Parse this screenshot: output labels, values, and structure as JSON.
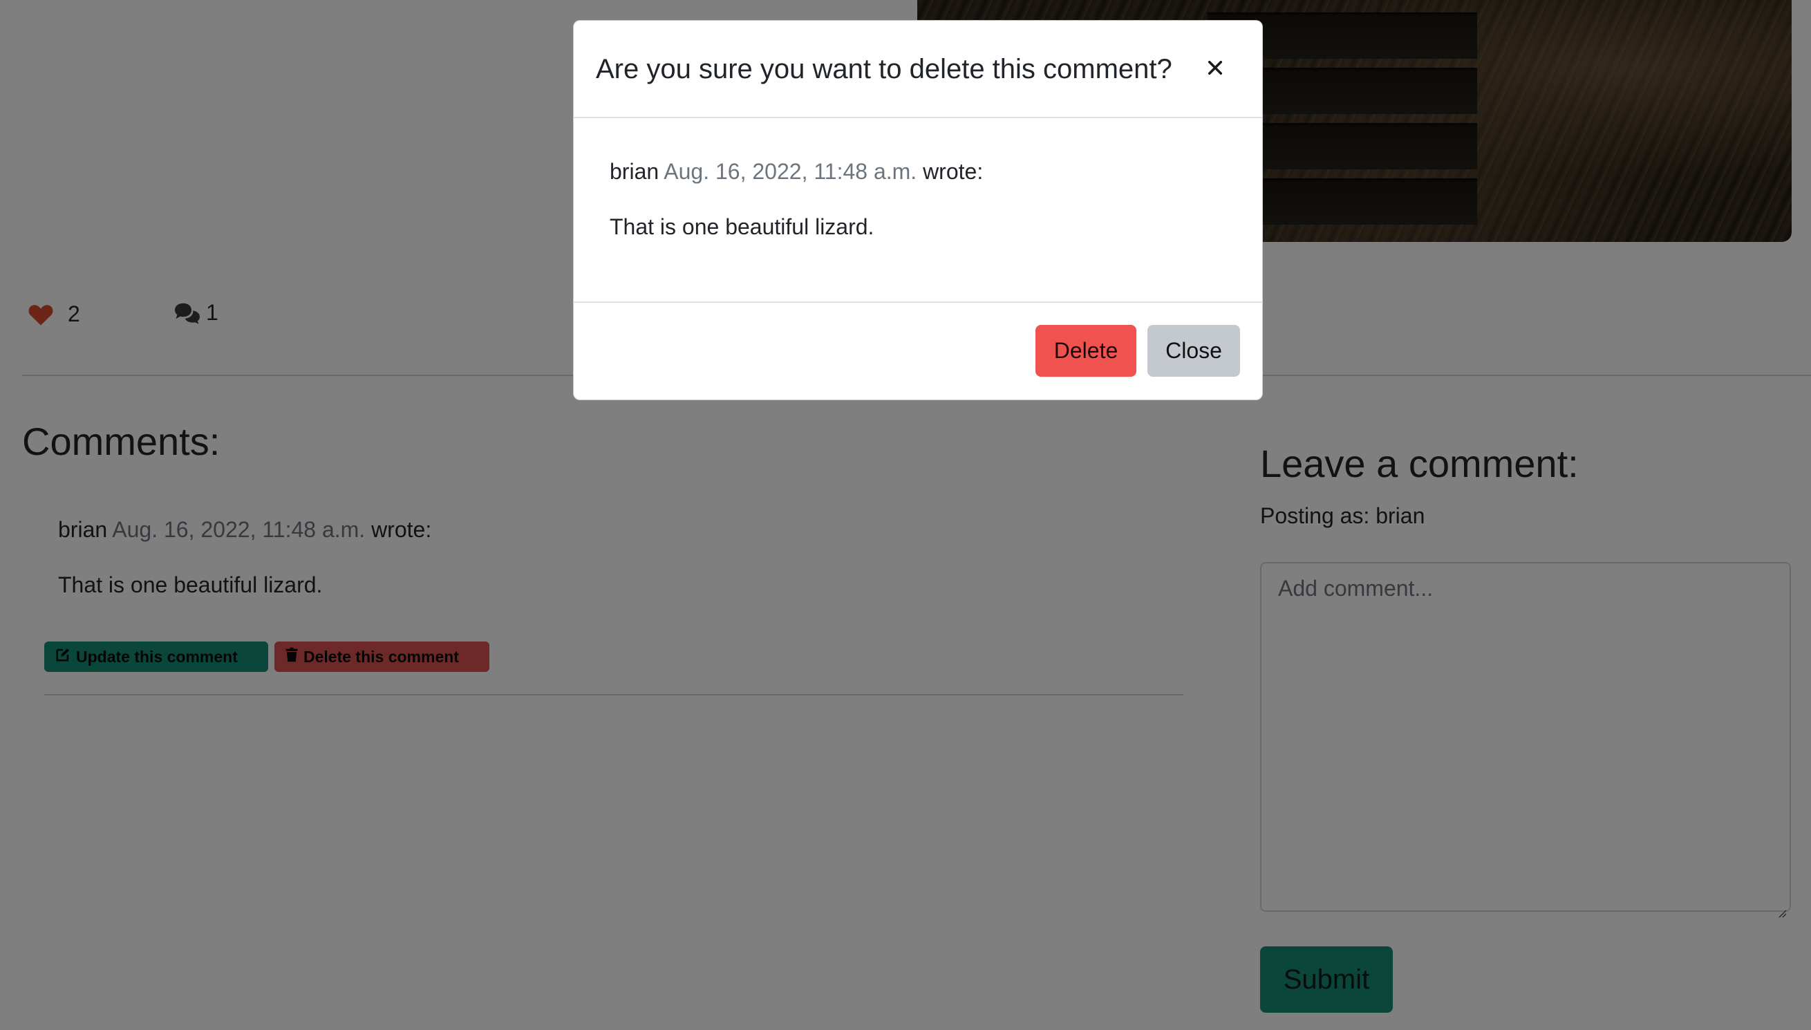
{
  "post": {
    "likes_count": "2",
    "comments_count": "1"
  },
  "comments_section": {
    "heading": "Comments:",
    "comment": {
      "author": "brian",
      "date": "Aug. 16, 2022, 11:48 a.m.",
      "wrote": "wrote:",
      "body": "That is one beautiful lizard.",
      "update_label": "Update this comment",
      "delete_label": "Delete this comment"
    }
  },
  "comment_form": {
    "heading": "Leave a comment:",
    "posting_as": "Posting as: brian",
    "placeholder": "Add comment...",
    "submit_label": "Submit"
  },
  "modal": {
    "title": "Are you sure you want to delete this comment?",
    "close_icon": "×",
    "author": "brian",
    "date": "Aug. 16, 2022, 11:48 a.m.",
    "wrote": "wrote:",
    "body": "That is one beautiful lizard.",
    "delete_label": "Delete",
    "close_label": "Close"
  },
  "colors": {
    "accent_green": "#158c73",
    "danger_red": "#f0534f",
    "heart": "#c0392b"
  }
}
